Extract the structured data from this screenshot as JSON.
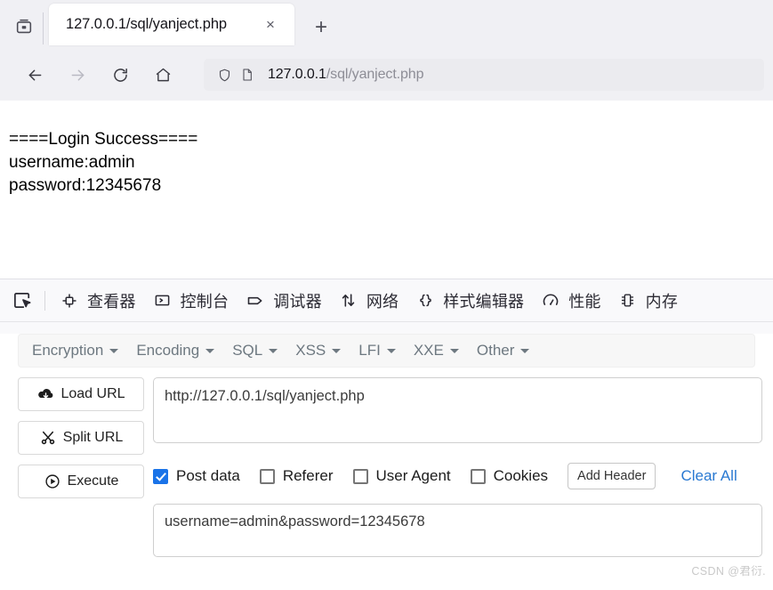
{
  "browser": {
    "tab": {
      "title": "127.0.0.1/sql/yanject.php",
      "close_label": "×"
    },
    "new_tab_label": "+",
    "nav": {
      "back": "back-arrow",
      "forward": "forward-arrow",
      "reload": "reload",
      "home": "home"
    },
    "urlbar": {
      "host": "127.0.0.1",
      "path": "/sql/yanject.php",
      "shield_icon": "shield-icon",
      "page_icon": "page-icon"
    }
  },
  "page": {
    "lines": [
      "====Login Success====",
      "username:admin",
      "password:12345678"
    ]
  },
  "devtools": {
    "picker_icon": "element-picker-icon",
    "tabs": [
      {
        "label": "查看器",
        "icon": "inspector-icon"
      },
      {
        "label": "控制台",
        "icon": "console-icon"
      },
      {
        "label": "调试器",
        "icon": "debugger-icon"
      },
      {
        "label": "网络",
        "icon": "network-icon"
      },
      {
        "label": "样式编辑器",
        "icon": "style-editor-icon"
      },
      {
        "label": "性能",
        "icon": "performance-icon"
      },
      {
        "label": "内存",
        "icon": "memory-icon"
      }
    ]
  },
  "hackbar": {
    "menu": [
      "Encryption",
      "Encoding",
      "SQL",
      "XSS",
      "LFI",
      "XXE",
      "Other"
    ],
    "actions": [
      {
        "label": "Load URL",
        "icon": "cloud-download-icon"
      },
      {
        "label": "Split URL",
        "icon": "scissors-icon"
      },
      {
        "label": "Execute",
        "icon": "play-circle-icon"
      }
    ],
    "url_value": "http://127.0.0.1/sql/yanject.php",
    "url_placeholder": "",
    "options": [
      {
        "label": "Post data",
        "checked": true
      },
      {
        "label": "Referer",
        "checked": false
      },
      {
        "label": "User Agent",
        "checked": false
      },
      {
        "label": "Cookies",
        "checked": false
      }
    ],
    "add_header_label": "Add Header",
    "clear_all_label": "Clear All",
    "post_data_value": "username=admin&password=12345678",
    "post_data_placeholder": ""
  },
  "watermark": "CSDN @君衍."
}
